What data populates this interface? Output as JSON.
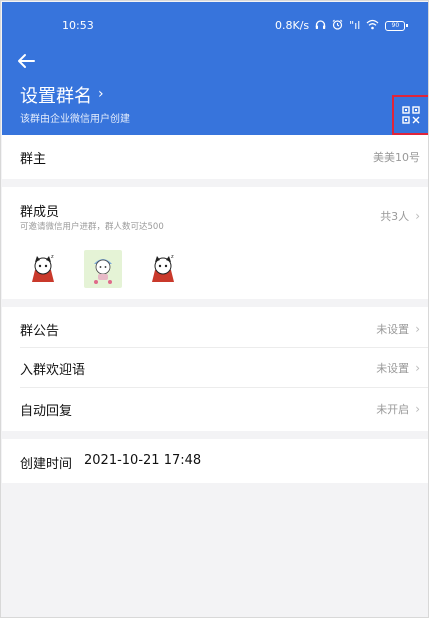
{
  "status_bar": {
    "time": "10:53",
    "speed": "0.8K/s",
    "signal": "\"ıl",
    "battery": "90"
  },
  "header": {
    "title": "设置群名",
    "subtitle": "该群由企业微信用户创建",
    "accent_color": "#3774dc",
    "highlight_color": "#e0243a"
  },
  "owner": {
    "label": "群主",
    "value": "美美10号"
  },
  "members": {
    "label": "群成员",
    "hint": "可邀请微信用户进群，群人数可达500",
    "count": "共3人",
    "avatars": [
      "avatar-cat-1",
      "avatar-bear",
      "avatar-cat-2"
    ]
  },
  "settings": {
    "announcement_label": "群公告",
    "announcement_value": "未设置",
    "welcome_label": "入群欢迎语",
    "welcome_value": "未设置",
    "auto_reply_label": "自动回复",
    "auto_reply_value": "未开启"
  },
  "created": {
    "label": "创建时间",
    "value": "2021-10-21 17:48"
  }
}
